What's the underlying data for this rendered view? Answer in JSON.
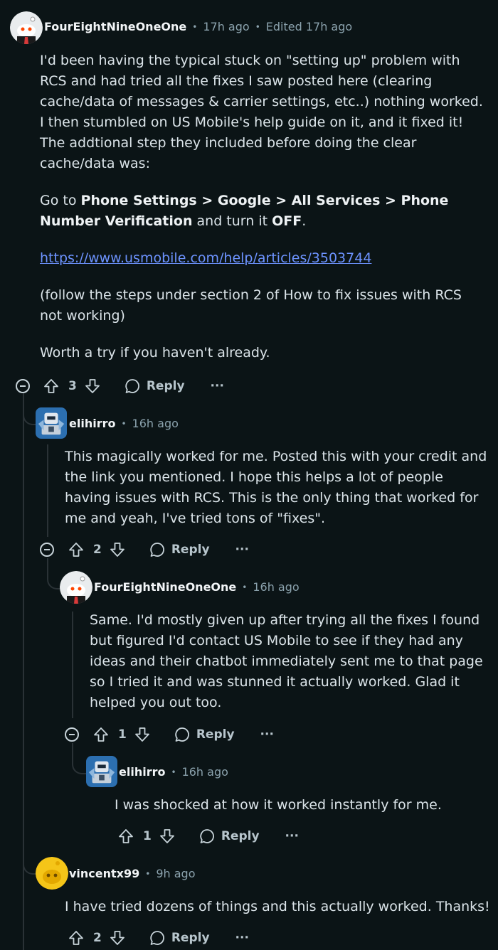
{
  "comments": [
    {
      "username": "FourEightNineOneOne",
      "time": "17h ago",
      "edited": "Edited 17h ago",
      "p1": "I'd been having the typical stuck on \"setting up\" problem with RCS and had tried all the fixes I saw posted here (clearing cache/data of messages & carrier settings, etc..) nothing worked. I then stumbled on US Mobile's help guide on it, and it fixed it! The addtional step they included before doing the clear cache/data was:",
      "p2_pre": "Go to ",
      "p2_bold": "Phone Settings > Google > All Services > Phone Number Verification",
      "p2_mid": " and turn it ",
      "p2_off": "OFF",
      "p2_end": ".",
      "link": "https://www.usmobile.com/help/articles/3503744",
      "p3": "(follow the steps under section 2 of How to fix issues with RCS not working)",
      "p4": "Worth a try if you haven't already.",
      "votes": "3",
      "reply": "Reply",
      "more": "···"
    },
    {
      "username": "elihirro",
      "time": "16h ago",
      "body": "This magically worked for me. Posted this with your credit and the link you mentioned. I hope this helps a lot of people having issues with RCS. This is the only thing that worked for me and yeah, I've tried tons of \"fixes\".",
      "votes": "2",
      "reply": "Reply",
      "more": "···"
    },
    {
      "username": "FourEightNineOneOne",
      "time": "16h ago",
      "body": "Same. I'd mostly given up after trying all the fixes I found but figured I'd contact US Mobile to see if they had any ideas and their chatbot immediately sent me to that page so I tried it and was stunned it actually worked. Glad it helped you out too.",
      "votes": "1",
      "reply": "Reply",
      "more": "···"
    },
    {
      "username": "elihirro",
      "time": "16h ago",
      "body": "I was shocked at how it worked instantly for me.",
      "votes": "1",
      "reply": "Reply",
      "more": "···"
    },
    {
      "username": "vincentx99",
      "time": "9h ago",
      "body": "I have tried dozens of things and this actually worked. Thanks!",
      "votes": "2",
      "reply": "Reply",
      "more": "···"
    }
  ],
  "icons": {
    "upvote": "upvote-icon",
    "downvote": "downvote-icon",
    "reply": "reply-bubble-icon",
    "collapse": "collapse-minus-icon",
    "more": "overflow-dots-icon"
  },
  "colors": {
    "background": "#0b1416",
    "link": "#6d93ff",
    "muted": "#8ba2ad",
    "thread_line": "#2a3236"
  }
}
